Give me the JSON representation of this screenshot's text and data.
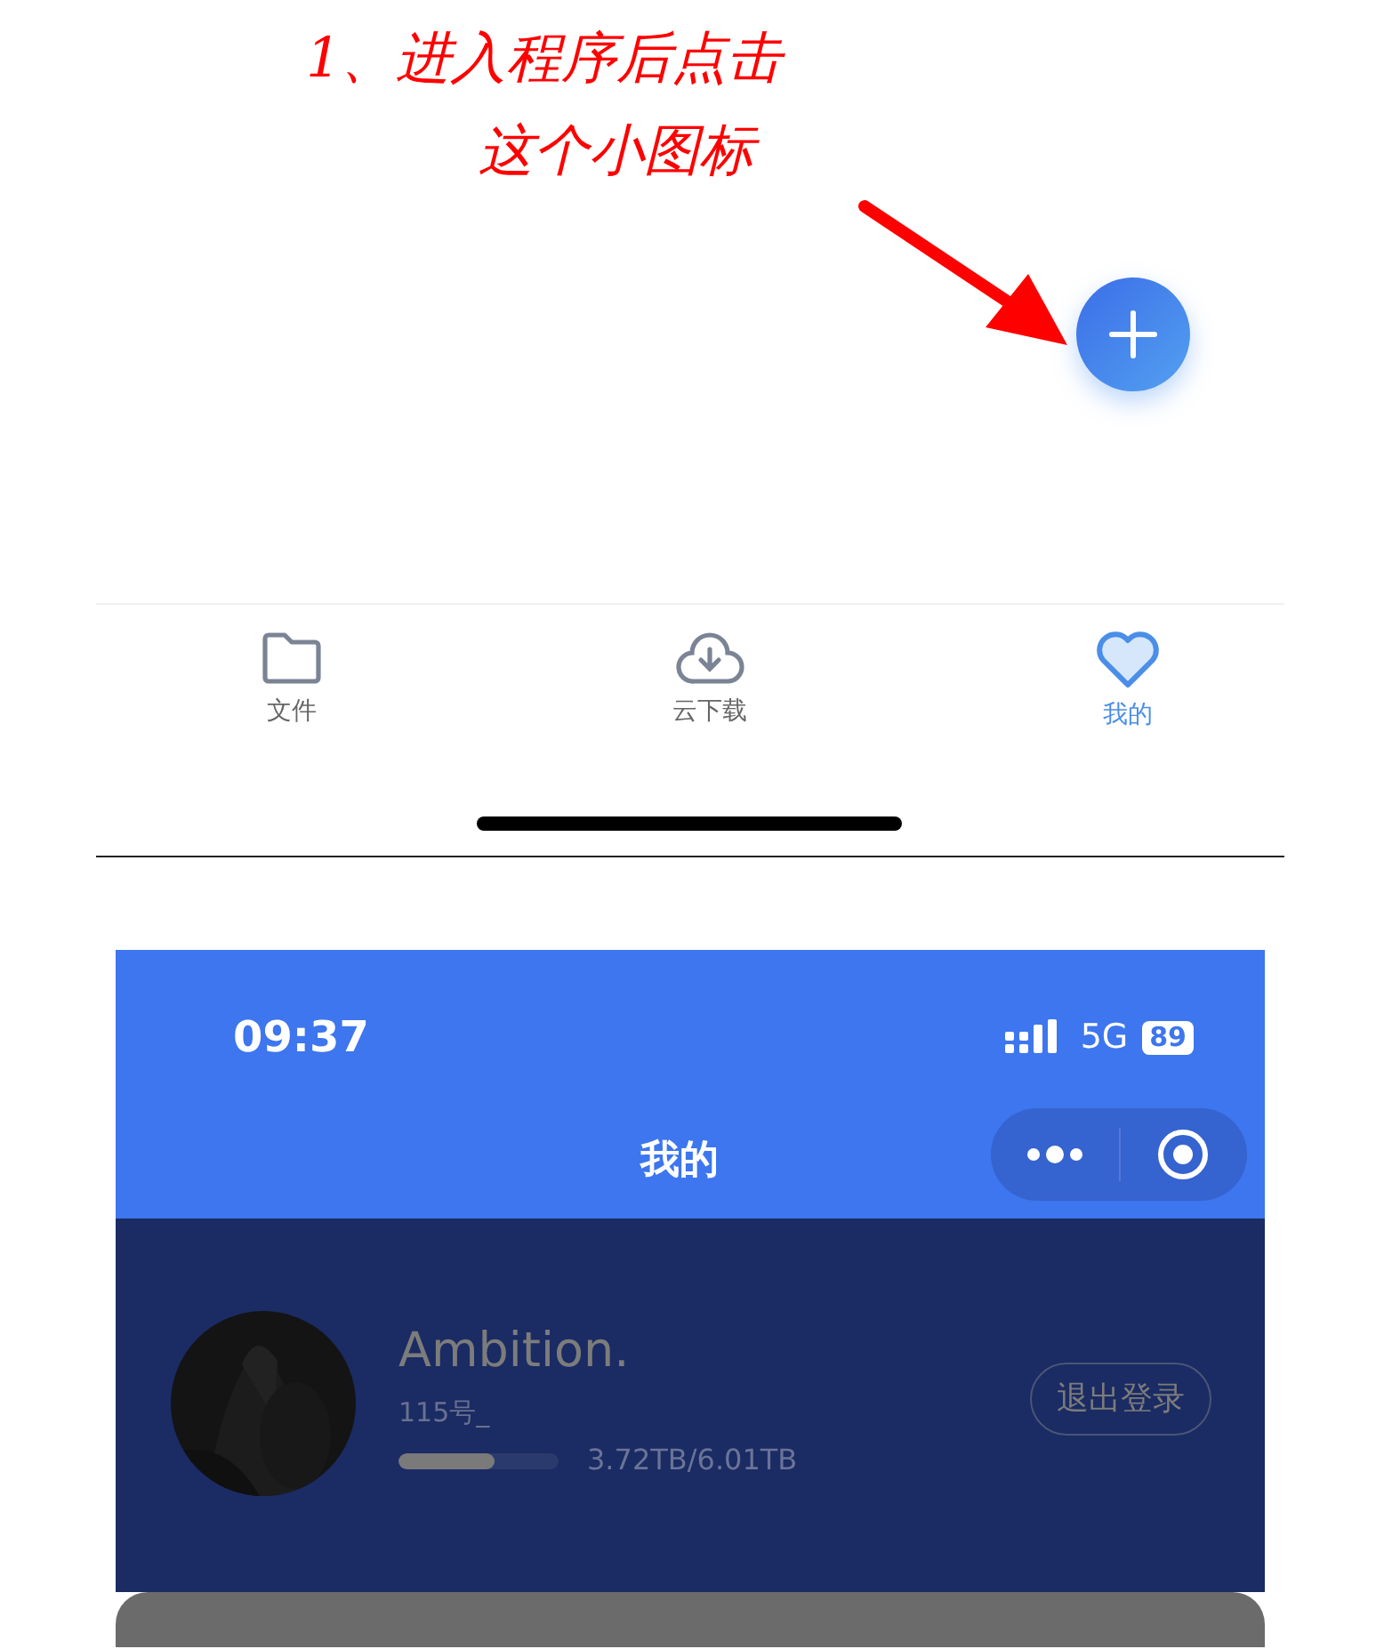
{
  "annotation": {
    "lines": [
      "1、进入程序后点击",
      "这个小图标"
    ]
  },
  "tab_bar": [
    {
      "kind": "folder",
      "label": "文件",
      "selected": false
    },
    {
      "kind": "cloud-download",
      "label": "云下载",
      "selected": false
    },
    {
      "kind": "heart",
      "label": "我的",
      "selected": true
    }
  ],
  "status_bar": {
    "time": "09:37",
    "network": "5G",
    "battery": "89"
  },
  "nav_bar": {
    "title": "我的"
  },
  "profile": {
    "name": "Ambition.",
    "account": "115号_",
    "storage": {
      "level": 0.6,
      "reading": "3.72TB/6.01TB"
    },
    "logout_button": "退出登录"
  }
}
